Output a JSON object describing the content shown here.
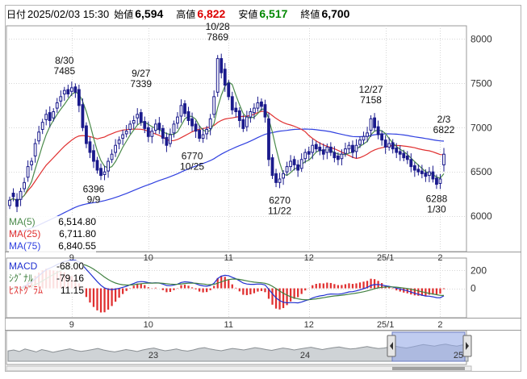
{
  "header": {
    "date_label": "日付",
    "date_value": "2025/02/03 15:30",
    "open_label": "始値",
    "open_value": "6,594",
    "high_label": "高値",
    "high_value": "6,822",
    "low_label": "安値",
    "low_value": "6,517",
    "close_label": "終値",
    "close_value": "6,700",
    "colors": {
      "high": "#dd0000",
      "low": "#008800",
      "default": "#000000"
    }
  },
  "price_legend": {
    "items": [
      {
        "label": "MA(5)",
        "value": "6,514.80",
        "color": "#4a8a4a"
      },
      {
        "label": "MA(25)",
        "value": "6,711.80",
        "color": "#e03030"
      },
      {
        "label": "MA(75)",
        "value": "6,840.55",
        "color": "#3040e0"
      }
    ]
  },
  "macd_legend": {
    "items": [
      {
        "label": "MACD",
        "value": "-68.00",
        "color": "#2030d0"
      },
      {
        "label": "ｼｸﾞﾅﾙ",
        "value": "-79.16",
        "color": "#408040"
      },
      {
        "label": "ﾋｽﾄｸﾞﾗﾑ",
        "value": "11.15",
        "color": "#e03030"
      }
    ]
  },
  "x_ticks": [
    "9",
    "10",
    "11",
    "12",
    "25/1",
    "2"
  ],
  "nav_ticks": [
    "23",
    "24",
    "25"
  ],
  "chart_data": [
    {
      "type": "candlestick",
      "ylim": [
        5600,
        8150
      ],
      "yticks": [
        6000,
        6500,
        7000,
        7500,
        8000
      ],
      "grid": true,
      "candle_colors": {
        "up": "#ffffff",
        "down": "#1a1a8c",
        "outline": "#1a1a8c"
      },
      "annotations": [
        {
          "date": "8/30",
          "value": "7485",
          "kind": "high"
        },
        {
          "date": "9/9",
          "value": "6396",
          "kind": "low"
        },
        {
          "date": "9/27",
          "value": "7339",
          "kind": "high"
        },
        {
          "date": "10/25",
          "value": "6770",
          "kind": "low"
        },
        {
          "date": "10/28",
          "value": "7869",
          "kind": "high"
        },
        {
          "date": "11/22",
          "value": "6270",
          "kind": "low"
        },
        {
          "date": "12/27",
          "value": "7158",
          "kind": "high"
        },
        {
          "date": "1/30",
          "value": "6288",
          "kind": "low"
        },
        {
          "date": "2/3",
          "value": "6822",
          "kind": "high"
        }
      ],
      "closes": [
        6180,
        6220,
        6110,
        6280,
        6380,
        6560,
        6620,
        6820,
        6950,
        7060,
        7150,
        7080,
        7180,
        7280,
        7350,
        7420,
        7380,
        7450,
        7400,
        7250,
        7000,
        6820,
        6720,
        6620,
        6520,
        6460,
        6500,
        6620,
        6700,
        6800,
        6860,
        6920,
        6960,
        7040,
        7080,
        7150,
        7060,
        6990,
        6900,
        6960,
        7040,
        6980,
        6880,
        6800,
        6920,
        7040,
        7120,
        7250,
        7160,
        7080,
        7020,
        6960,
        6880,
        6920,
        6980,
        7100,
        7350,
        7780,
        7620,
        7480,
        7350,
        7200,
        7180,
        7080,
        6990,
        7120,
        7180,
        7220,
        7280,
        7240,
        7120,
        6640,
        6460,
        6380,
        6420,
        6480,
        6560,
        6620,
        6580,
        6520,
        6640,
        6720,
        6700,
        6800,
        6760,
        6740,
        6700,
        6780,
        6720,
        6660,
        6640,
        6700,
        6760,
        6800,
        6720,
        6800,
        6860,
        6900,
        6940,
        7100,
        7000,
        6920,
        6860,
        6780,
        6820,
        6760,
        6720,
        6700,
        6660,
        6640,
        6560,
        6520,
        6500,
        6480,
        6450,
        6500,
        6420,
        6360,
        6420,
        6700
      ],
      "open_offsets": [
        -60,
        40,
        80,
        -90,
        -70,
        -120,
        -40,
        -140,
        -100,
        -80,
        -60,
        90,
        -70,
        -60,
        -50,
        -40,
        50,
        -40,
        60,
        180,
        260,
        200,
        120,
        120,
        110,
        80,
        -30,
        -110,
        -60,
        -80,
        -40,
        -40,
        -30,
        -60,
        -30,
        -40,
        110,
        80,
        100,
        -60,
        -70,
        70,
        110,
        90,
        -100,
        -100,
        -70,
        -120,
        110,
        100,
        80,
        80,
        90,
        -40,
        -50,
        -110,
        -200,
        -380,
        160,
        180,
        150,
        150,
        40,
        110,
        100,
        -110,
        -60,
        -50,
        -60,
        50,
        140,
        460,
        200,
        100,
        -40,
        -50,
        -60,
        -60,
        60,
        60,
        -100,
        -70,
        30,
        -80,
        50,
        40,
        50,
        -60,
        60,
        60,
        40,
        -50,
        -50,
        -40,
        80,
        -70,
        -50,
        -40,
        -40,
        -130,
        110,
        90,
        70,
        80,
        -40,
        70,
        50,
        30,
        50,
        40,
        80,
        50,
        30,
        30,
        40,
        -40,
        80,
        70,
        -50,
        -120
      ]
    },
    {
      "type": "line",
      "ylim": [
        -330,
        340
      ],
      "yticks": [
        0,
        200
      ],
      "series": [
        {
          "name": "MACD"
        },
        {
          "name": "ｼｸﾞﾅﾙ"
        },
        {
          "name": "ﾋｽﾄｸﾞﾗﾑ"
        }
      ]
    },
    {
      "type": "area",
      "values": [
        0.45,
        0.5,
        0.42,
        0.55,
        0.48,
        0.4,
        0.52,
        0.46,
        0.38,
        0.44,
        0.5,
        0.56,
        0.48,
        0.43,
        0.47,
        0.52,
        0.58,
        0.5,
        0.44,
        0.4,
        0.46,
        0.52,
        0.48,
        0.42,
        0.5,
        0.56,
        0.6,
        0.52,
        0.46,
        0.5,
        0.55,
        0.48,
        0.44,
        0.5,
        0.58,
        0.62,
        0.55,
        0.5,
        0.46,
        0.52,
        0.58,
        0.54,
        0.5,
        0.56,
        0.62,
        0.58,
        0.52,
        0.48,
        0.54,
        0.6,
        0.56,
        0.5,
        0.55,
        0.6,
        0.64,
        0.58,
        0.52,
        0.57,
        0.62,
        0.66,
        0.6,
        0.55,
        0.58,
        0.63,
        0.68,
        0.62,
        0.57,
        0.6,
        0.66,
        0.7,
        0.64,
        0.6,
        0.66,
        0.72,
        0.78,
        0.74,
        0.7,
        0.76,
        0.8,
        0.74,
        0.7,
        0.76,
        0.72
      ]
    }
  ]
}
